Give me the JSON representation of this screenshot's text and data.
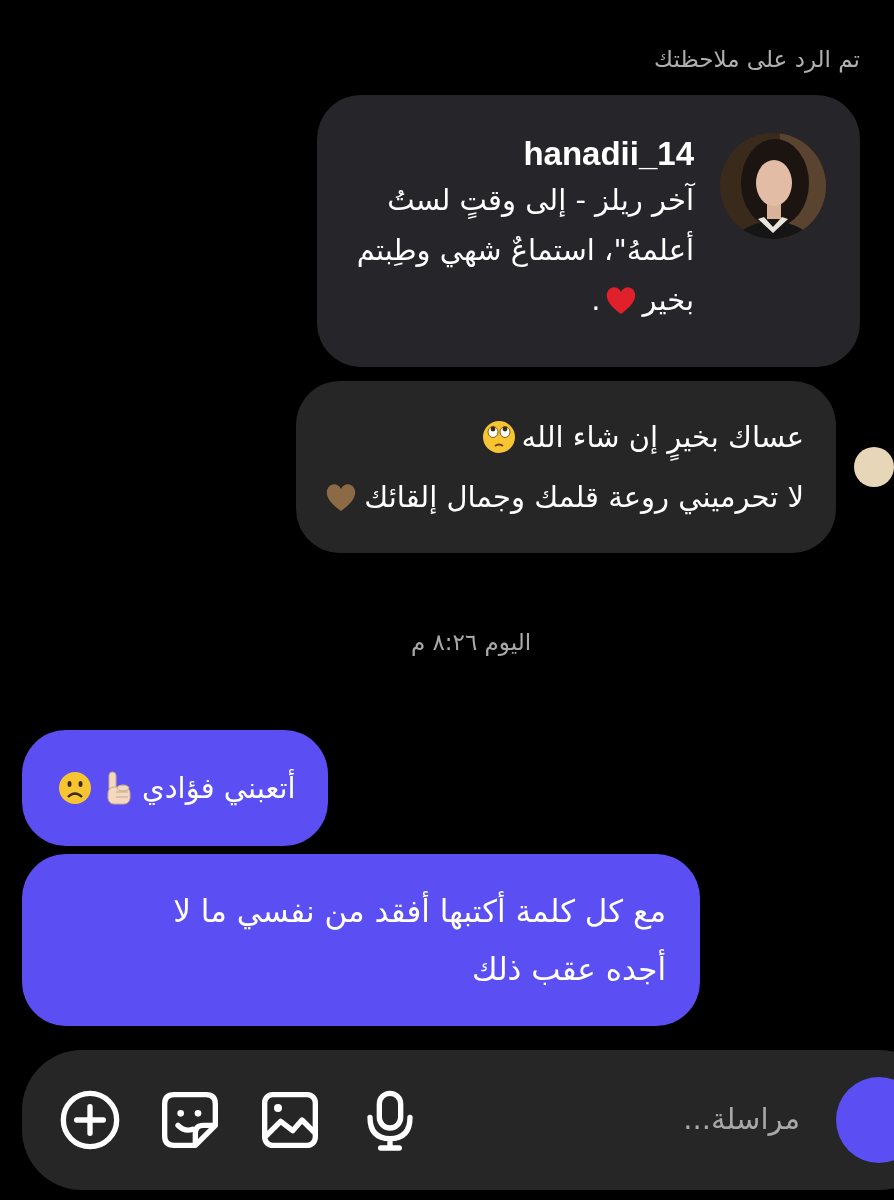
{
  "reply_label": "تم الرد على ملاحظتك",
  "quoted_note": {
    "username": "hanadii_14",
    "lines": [
      [
        {
          "kind": "text",
          "text": "آخر ريلز - إلى وقتٍ لستُ"
        }
      ],
      [
        {
          "kind": "text",
          "text": "أعلمهُ\"، استماعٌ شهي وطِبتم"
        }
      ],
      [
        {
          "kind": "text",
          "text": "بخير"
        },
        {
          "kind": "red-heart"
        },
        {
          "kind": "text",
          "text": "."
        }
      ]
    ]
  },
  "messages": [
    {
      "kind": "incoming",
      "lines": [
        [
          {
            "kind": "text",
            "text": "عساك بخيرٍ إن شاء الله"
          },
          {
            "kind": "eye-roll"
          }
        ],
        [
          {
            "kind": "text",
            "text": "لا تحرميني روعة قلمك وجمال إلقائك"
          },
          {
            "kind": "brown-heart"
          }
        ]
      ]
    },
    {
      "kind": "timestamp",
      "lines": [
        [
          {
            "kind": "text",
            "text": "اليوم ٨:٢٦ م"
          }
        ]
      ]
    },
    {
      "kind": "outgoing",
      "lines": [
        [
          {
            "kind": "text",
            "text": "أتعبني فؤادي"
          },
          {
            "kind": "pointing-up"
          },
          {
            "kind": "frown"
          }
        ]
      ]
    },
    {
      "kind": "outgoing",
      "lines": [
        [
          {
            "kind": "text",
            "text": "مع كل كلمة أكتبها أفقد من نفسي ما لا أجده عقب ذلك"
          }
        ]
      ]
    }
  ],
  "composer": {
    "placeholder": "مراسلة..."
  }
}
